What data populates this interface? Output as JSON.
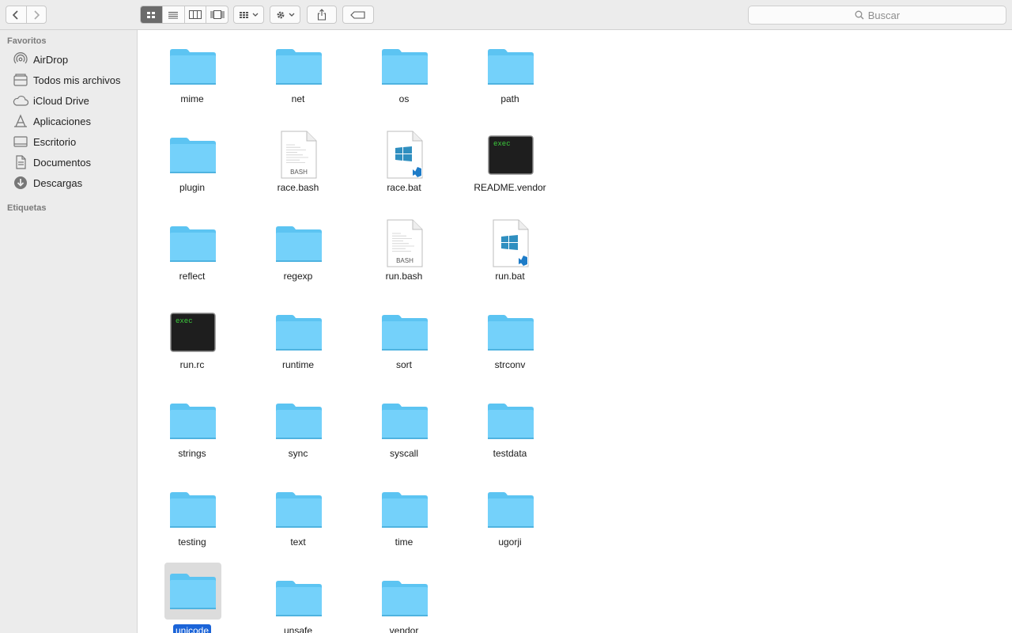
{
  "toolbar": {
    "search_placeholder": "Buscar"
  },
  "sidebar": {
    "favorites_header": "Favoritos",
    "items": [
      {
        "label": "AirDrop",
        "icon": "airdrop-icon"
      },
      {
        "label": "Todos mis archivos",
        "icon": "all-files-icon"
      },
      {
        "label": "iCloud Drive",
        "icon": "cloud-icon"
      },
      {
        "label": "Aplicaciones",
        "icon": "applications-icon"
      },
      {
        "label": "Escritorio",
        "icon": "desktop-icon"
      },
      {
        "label": "Documentos",
        "icon": "documents-icon"
      },
      {
        "label": "Descargas",
        "icon": "downloads-icon"
      }
    ],
    "tags_header": "Etiquetas"
  },
  "files": [
    {
      "name": "mime",
      "type": "folder"
    },
    {
      "name": "net",
      "type": "folder"
    },
    {
      "name": "os",
      "type": "folder"
    },
    {
      "name": "path",
      "type": "folder"
    },
    {
      "name": "plugin",
      "type": "folder"
    },
    {
      "name": "race.bash",
      "type": "bash",
      "badge": "BASH"
    },
    {
      "name": "race.bat",
      "type": "bat"
    },
    {
      "name": "README.vendor",
      "type": "exec",
      "badge": "exec"
    },
    {
      "name": "reflect",
      "type": "folder"
    },
    {
      "name": "regexp",
      "type": "folder"
    },
    {
      "name": "run.bash",
      "type": "bash",
      "badge": "BASH"
    },
    {
      "name": "run.bat",
      "type": "bat"
    },
    {
      "name": "run.rc",
      "type": "exec",
      "badge": "exec"
    },
    {
      "name": "runtime",
      "type": "folder"
    },
    {
      "name": "sort",
      "type": "folder"
    },
    {
      "name": "strconv",
      "type": "folder"
    },
    {
      "name": "strings",
      "type": "folder"
    },
    {
      "name": "sync",
      "type": "folder"
    },
    {
      "name": "syscall",
      "type": "folder"
    },
    {
      "name": "testdata",
      "type": "folder"
    },
    {
      "name": "testing",
      "type": "folder"
    },
    {
      "name": "text",
      "type": "folder"
    },
    {
      "name": "time",
      "type": "folder"
    },
    {
      "name": "ugorji",
      "type": "folder"
    },
    {
      "name": "unicode",
      "type": "folder",
      "selected": true
    },
    {
      "name": "unsafe",
      "type": "folder"
    },
    {
      "name": "vendor",
      "type": "folder"
    }
  ]
}
